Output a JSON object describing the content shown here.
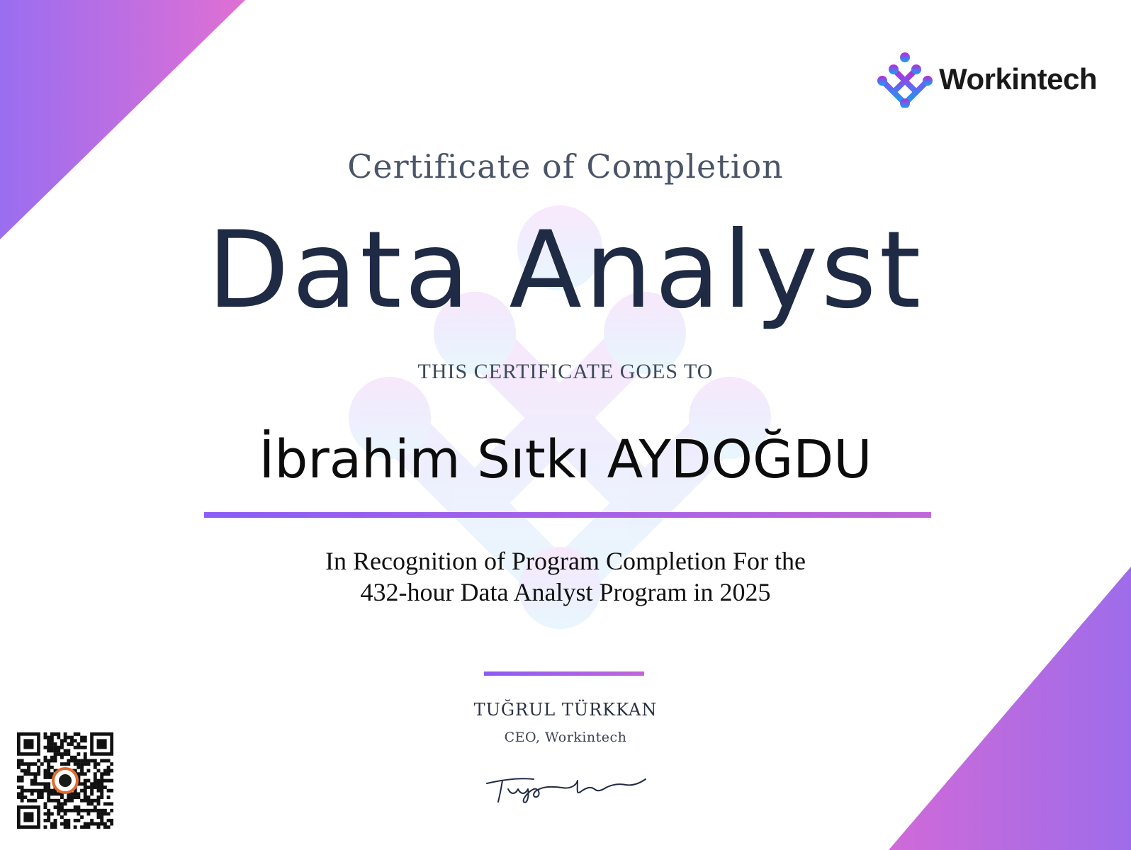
{
  "certificate": {
    "heading": "Certificate of Completion",
    "program": "Data Analyst",
    "intro": "THIS CERTIFICATE GOES TO",
    "recipient": "İbrahim Sıtkı AYDOĞDU",
    "recognition_line1": "In Recognition of Program Completion For the",
    "recognition_line2": "432-hour Data Analyst Program in 2025"
  },
  "brand": {
    "name": "Workintech",
    "logo_icon": "workintech-dots-logo-icon"
  },
  "signatory": {
    "name": "TUĞRUL TÜRKKAN",
    "title": "CEO, Workintech"
  },
  "colors": {
    "accent_purple": "#8b5cf6",
    "accent_pink": "#c067d9",
    "title_navy": "#1f2a44"
  }
}
